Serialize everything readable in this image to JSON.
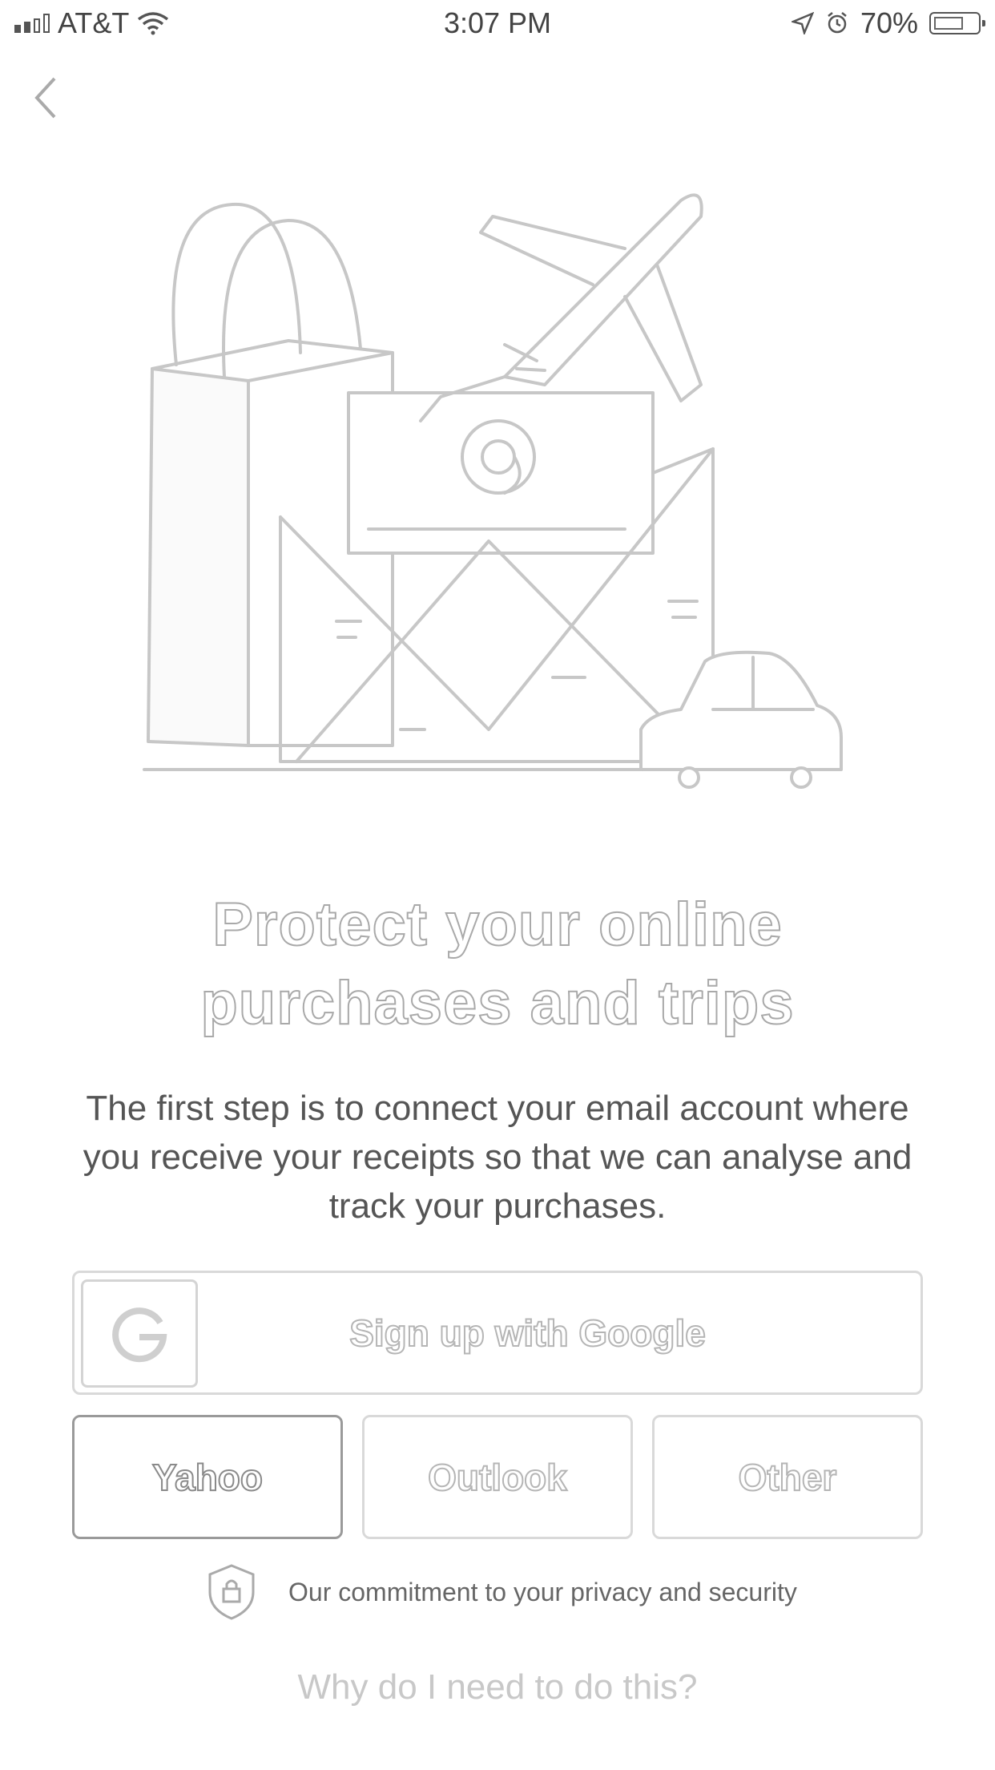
{
  "status_bar": {
    "carrier": "AT&T",
    "time": "3:07 PM",
    "battery": "70%",
    "icons": [
      "signal-icon",
      "wifi-icon",
      "location-icon",
      "alarm-icon",
      "battery-icon"
    ]
  },
  "nav": {
    "back_icon": "chevron-left-icon"
  },
  "hero": {
    "icon": "shopping-bag-email-plane-car-illustration"
  },
  "content": {
    "title_line1": "Protect your online",
    "title_line2": "purchases and trips",
    "body_line1": "The first step is to connect your email account where",
    "body_line2": "you receive your receipts so that we can analyse and",
    "body_line3": "track your purchases."
  },
  "buttons": {
    "google": "Sign up with Google",
    "yahoo": "Yahoo",
    "outlook": "Outlook",
    "other": "Other"
  },
  "privacy": {
    "text": "Our commitment to your privacy and security",
    "icon": "shield-lock-icon"
  },
  "footer": {
    "why_link": "Why do I need to do this?"
  }
}
